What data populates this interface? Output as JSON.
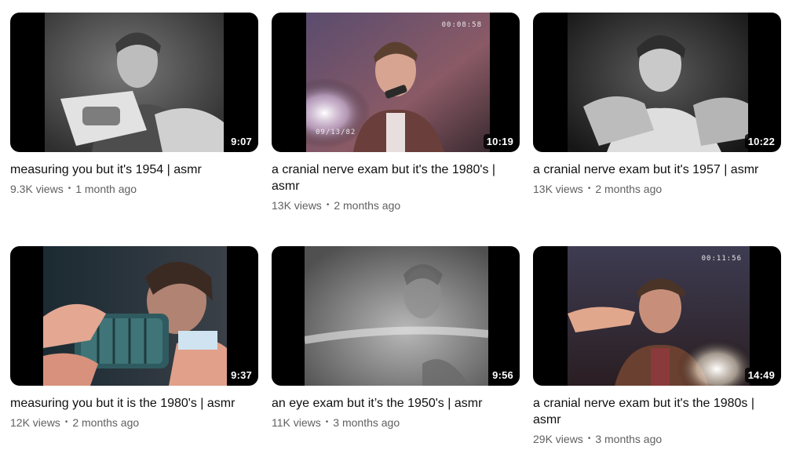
{
  "videos": [
    {
      "title": "measuring you but it's 1954 | asmr",
      "duration": "9:07",
      "views": "9.3K views",
      "age": "1 month ago"
    },
    {
      "title": "a cranial nerve exam but it's the 1980's | asmr",
      "duration": "10:19",
      "views": "13K views",
      "age": "2 months ago",
      "stamp_top": "00:08:58",
      "stamp_bottom": "09/13/82"
    },
    {
      "title": "a cranial nerve exam but it's 1957 | asmr",
      "duration": "10:22",
      "views": "13K views",
      "age": "2 months ago"
    },
    {
      "title": "measuring you but it is the 1980's | asmr",
      "duration": "9:37",
      "views": "12K views",
      "age": "2 months ago"
    },
    {
      "title": "an eye exam but it’s the 1950's | asmr",
      "duration": "9:56",
      "views": "11K views",
      "age": "3 months ago"
    },
    {
      "title": "a cranial nerve exam but it's the 1980s | asmr",
      "duration": "14:49",
      "views": "29K views",
      "age": "3 months ago",
      "stamp_top": "00:11:56"
    }
  ],
  "separator": "•"
}
